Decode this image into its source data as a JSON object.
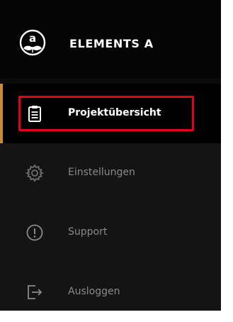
{
  "brand": {
    "title": "ELEMENTS A",
    "logo_icon": "elements-a-logo"
  },
  "nav": {
    "items": [
      {
        "label": "Projektübersicht",
        "icon": "clipboard-icon",
        "active": true
      },
      {
        "label": "Einstellungen",
        "icon": "gear-icon",
        "active": false
      },
      {
        "label": "Support",
        "icon": "exclamation-circle-icon",
        "active": false
      },
      {
        "label": "Ausloggen",
        "icon": "logout-icon",
        "active": false
      }
    ]
  },
  "colors": {
    "sidebar_bg": "#141414",
    "brand_bg": "#050505",
    "active_bg": "#000000",
    "accent": "#c88a3c",
    "highlight": "#e3001b",
    "inactive_text": "#8a8a8a",
    "active_text": "#ffffff"
  }
}
